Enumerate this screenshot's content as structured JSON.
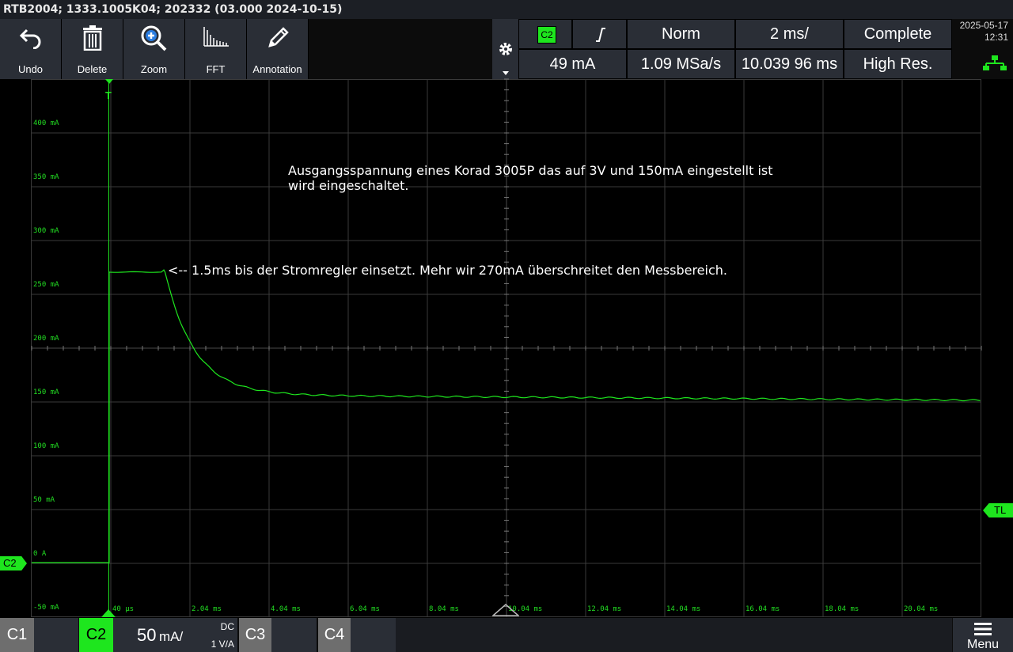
{
  "title_bar": {
    "text": "RTB2004; 1333.1005K04; 202332 (03.000 2024-10-15)"
  },
  "toolbar": {
    "undo": "Undo",
    "delete": "Delete",
    "zoom": "Zoom",
    "fft": "FFT",
    "annotation": "Annotation"
  },
  "status": {
    "channel_badge": "C2",
    "trigger_level": "49 mA",
    "mode": "Norm",
    "sample_rate": "1.09 MSa/s",
    "timebase": "2 ms/",
    "trigger_position": "10.039 96 ms",
    "acq_state": "Complete",
    "acq_mode": "High Res.",
    "date": "2025-05-17",
    "time": "12:31"
  },
  "plot": {
    "y_labels": [
      "400 mA",
      "350 mA",
      "300 mA",
      "250 mA",
      "200 mA",
      "150 mA",
      "100 mA",
      "50 mA",
      "0 A",
      "-50 mA"
    ],
    "x_labels": [
      "40 µs",
      "2.04 ms",
      "4.04 ms",
      "6.04 ms",
      "8.04 ms",
      "10.04 ms",
      "12.04 ms",
      "14.04 ms",
      "16.04 ms",
      "18.04 ms",
      "20.04 ms"
    ],
    "annotation_1_line1": "Ausgangsspannung eines Korad 3005P das auf 3V und 150mA eingestellt ist",
    "annotation_1_line2": "wird eingeschaltet.",
    "annotation_2": "<-- 1.5ms bis der Stromregler einsetzt. Mehr wir 270mA überschreitet den Messbereich.",
    "trigger_marker": "T",
    "channel_marker": "C2",
    "trigger_level_marker": "TL",
    "trace_color": "#1ee61e"
  },
  "channels": {
    "c1": "C1",
    "c2": "C2",
    "c2_scale": "50",
    "c2_unit": "mA/",
    "c2_coupling": "DC",
    "c2_factor": "1 V/A",
    "c3": "C3",
    "c4": "C4",
    "menu": "Menu"
  }
}
